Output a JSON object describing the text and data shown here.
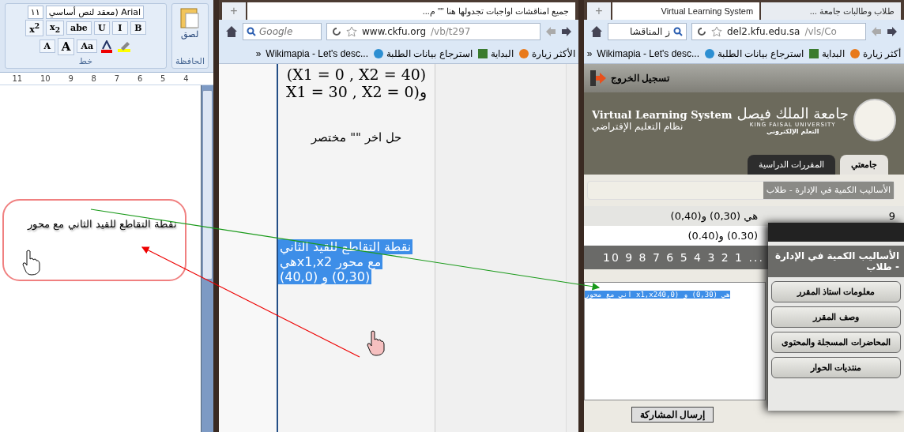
{
  "word": {
    "font_name": "معقد لنص أساسي) Arial",
    "font_size": "١١",
    "format_buttons": [
      "B",
      "I",
      "U",
      "abe",
      "x$_{2}$",
      "x$^{2}$"
    ],
    "case_button": "Aa",
    "grow_buttons": [
      "A",
      "A"
    ],
    "paste": "لصق",
    "groups": [
      "الحافظة",
      "خط"
    ],
    "ruler": [
      "4",
      "5",
      "6",
      "7",
      "8",
      "9",
      "10",
      "11"
    ]
  },
  "annotation": {
    "text": "نقطة التقاطع للقيد الثاني مع محور"
  },
  "forum_browser": {
    "new_tab": "+",
    "tabs": [
      {
        "title": "جميع امناقشات اواجبات تجدولها هنا \"\" م...",
        "selected": true
      }
    ],
    "search": "Google",
    "url_host": "www.ckfu.org",
    "url_path": "/vb/t297",
    "bookmarks": [
      "الأكثر زيارة",
      "البداية",
      "استرجاع بيانات الطلبة",
      "Wikimapia - Let's desc..."
    ],
    "more": "»"
  },
  "forum_page": {
    "lines": [
      "(X1 = 0 , X2 = 40)",
      "X1 = 30 , X2 = 0)و"
    ],
    "note": "حل اخر \"\" مختصر",
    "dragged": [
      "نقطة التقاطع للقيد الثاني",
      "مع محور x1,x2هي",
      "(0,30) و (40,0)"
    ]
  },
  "vls_browser": {
    "new_tab": "+",
    "tabs": [
      {
        "title": "طلاب وطالبات جامعة ...",
        "selected": false
      },
      {
        "title": "Virtual Learning System",
        "selected": true
      }
    ],
    "search": "ز المناقشا",
    "url_host": "del2.kfu.edu.sa",
    "url_path": "/vls/Co",
    "bookmarks": [
      "أكثر زيارة",
      "البداية",
      "استرجاع بيانات الطلبة",
      "Wikimapia - Let's desc..."
    ],
    "more": "»"
  },
  "vls_page": {
    "logout": "تسجيل الخروج",
    "uni_ar": "جامعة الملك فيصل",
    "uni_en": "KING FAISAL UNIVERSITY",
    "elearning": "التعلم الإلكتروني",
    "system_en": "Virtual Learning System",
    "system_ar": "نظام التعليم الإفتراضي",
    "tabs": [
      {
        "label": "جامعتي",
        "selected": true
      },
      {
        "label": "المقررات الدراسية",
        "selected": false
      }
    ],
    "breadcrumb": "الأساليب الكمية في الإدارة - طلاب",
    "rows": [
      {
        "number": "9",
        "text": "هي (0,30) و(0,40)"
      },
      {
        "text": "(0.30) و(0.40)"
      }
    ],
    "pages": "10 9 8 7 6 5 4 3 2 1 ...",
    "editor_text": "اني مع محور x1,x2هي (0,30) و (40,0",
    "submit": "إرسال المشاركة",
    "menu": {
      "title": "الأساليب الكمية في الإدارة - طلاب",
      "items": [
        "معلومات استاذ المقرر",
        "وصف المقرر",
        "المحاضرات المسجلة والمحتوى",
        "منتديات الحوار"
      ]
    }
  }
}
